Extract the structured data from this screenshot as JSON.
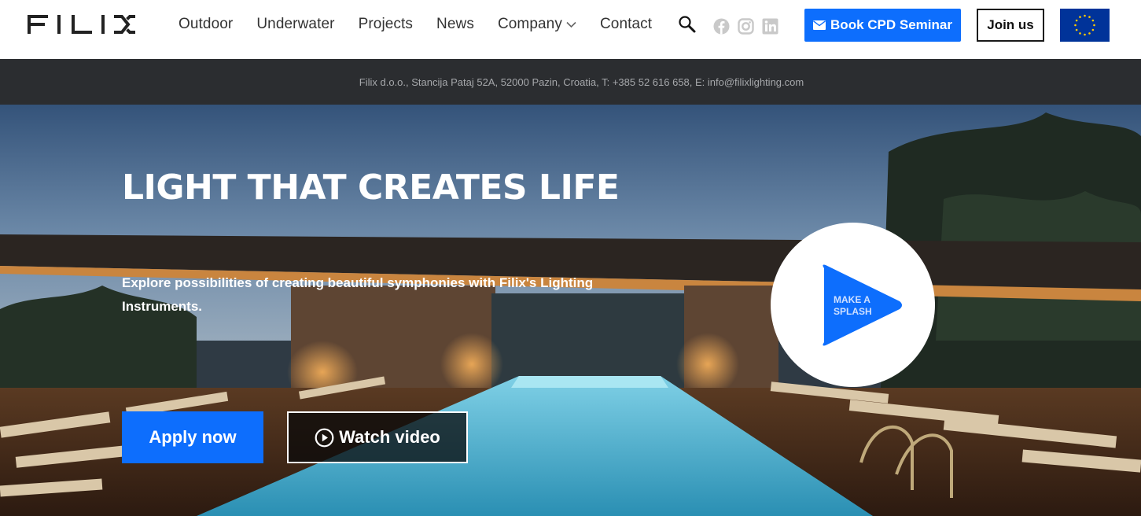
{
  "brand": {
    "logo_text": "FILIX"
  },
  "nav": {
    "items": [
      {
        "label": "Outdoor"
      },
      {
        "label": "Underwater"
      },
      {
        "label": "Projects"
      },
      {
        "label": "News"
      },
      {
        "label": "Company",
        "has_dropdown": true
      },
      {
        "label": "Contact"
      }
    ]
  },
  "header": {
    "search_icon": "search-icon",
    "socials": [
      "facebook-icon",
      "instagram-icon",
      "linkedin-icon"
    ],
    "cpd_button": "Book CPD Seminar",
    "join_button": "Join us",
    "eu_flag": "eu-flag-icon"
  },
  "infobar": {
    "text": "Filix d.o.o., Stancija Pataj 52A, 52000 Pazin, Croatia, T: +385 52 616 658, E: info@filixlighting.com"
  },
  "hero": {
    "title": "LIGHT THAT CREATES LIFE",
    "subtitle": "Explore possibilities of creating beautiful symphonies with Filix's Lighting Instruments.",
    "apply_button": "Apply now",
    "watch_button": "Watch video",
    "splash_line1": "MAKE A",
    "splash_line2": "SPLASH"
  },
  "colors": {
    "accent": "#0d6efd",
    "infobar_bg": "#2b2d30",
    "infobar_text": "#a6a8ab",
    "eu_blue": "#003399",
    "eu_star": "#ffcc00"
  }
}
